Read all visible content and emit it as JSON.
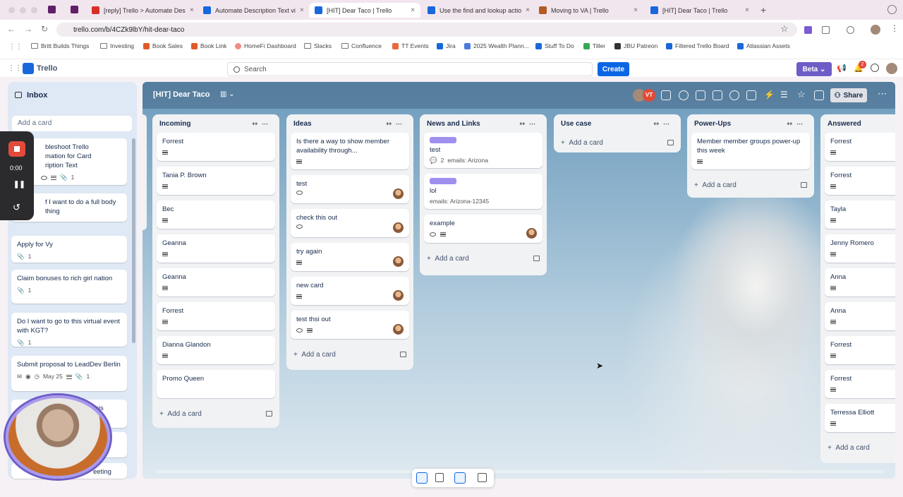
{
  "tabs": [
    {
      "title": "[reply] Trello > Automate Des",
      "color": "#d93025"
    },
    {
      "title": "Automate Description Text vi",
      "color": "#1868db"
    },
    {
      "title": "[HIT] Dear Taco | Trello",
      "color": "#1868db",
      "active": true
    },
    {
      "title": "Use the find and lookup actio",
      "color": "#1868db"
    },
    {
      "title": "Moving to VA | Trello",
      "color": "#b35b22"
    },
    {
      "title": "[HIT] Dear Taco | Trello",
      "color": "#1868db"
    }
  ],
  "url": "trello.com/b/4CZk9lbY/hit-dear-taco",
  "bookmarks": [
    "Britt Builds Things",
    "Investing",
    "Book Sales",
    "Book Link",
    "HomeFi Dashboard",
    "Slacks",
    "Confluence",
    "TT Events",
    "Jira",
    "2025 Wealth Plann...",
    "Stuff To Do",
    "Tiller",
    "JBU Patreon",
    "Filtered Trello Board",
    "Atlassian Assets"
  ],
  "app": {
    "name": "Trello",
    "search_placeholder": "Search",
    "create": "Create",
    "beta": "Beta",
    "notif_count": "2"
  },
  "inbox": {
    "title": "Inbox",
    "add": "Add a card",
    "cards": [
      {
        "title": "Troubleshoot Trello Automation for Card Description Text",
        "visible": "bleshoot Trello\nmation for Card\nription Text",
        "attach": "1"
      },
      {
        "title": "f I want to do a full body thing",
        "attach": ""
      },
      {
        "title": "Apply for Vy",
        "attach": "1"
      },
      {
        "title": "Claim bonuses to rich girl nation",
        "attach": "1"
      },
      {
        "title": "Do I want to go to this virtual event with KGT?",
        "attach": "1"
      },
      {
        "title": "Submit proposal to LeadDev Berlin",
        "date": "May 25",
        "attach": "1"
      }
    ],
    "partial": [
      "this",
      "eeting"
    ]
  },
  "recorder": {
    "time": "0:00"
  },
  "board": {
    "title": "[HIT] Dear Taco",
    "share": "Share",
    "member_initials": "VT",
    "lists": [
      {
        "name": "Incoming",
        "cards": [
          "Forrest",
          "Tania P. Brown",
          "Bec",
          "Geanna",
          "Geanna",
          "Forrest",
          "Dianna Glandon",
          "Promo Queen"
        ],
        "add": "Add a card"
      },
      {
        "name": "Ideas",
        "cards": [
          "Is there a way to show member availability through...",
          "test",
          "check this out",
          "try again",
          "new card",
          "test thsi out"
        ],
        "add": "Add a card"
      },
      {
        "name": "News and Links",
        "cards": [
          {
            "title": "test",
            "comments": "2",
            "email": "emails: Arizona"
          },
          {
            "title": "lol",
            "email": "emails: Arizona-12345"
          },
          {
            "title": "example"
          }
        ],
        "add": "Add a card"
      },
      {
        "name": "Use case",
        "cards": [],
        "add": "Add a card"
      },
      {
        "name": "Power-Ups",
        "cards": [
          "Member member groups power-up this week"
        ],
        "add": "Add a card"
      },
      {
        "name": "Answered",
        "cards": [
          "Forrest",
          "Forrest",
          "Tayla",
          "Jenny Romero",
          "Anna",
          "Anna",
          "Forrest",
          "Forrest",
          "Terressa Elliott"
        ],
        "add": "Add a card"
      }
    ]
  }
}
